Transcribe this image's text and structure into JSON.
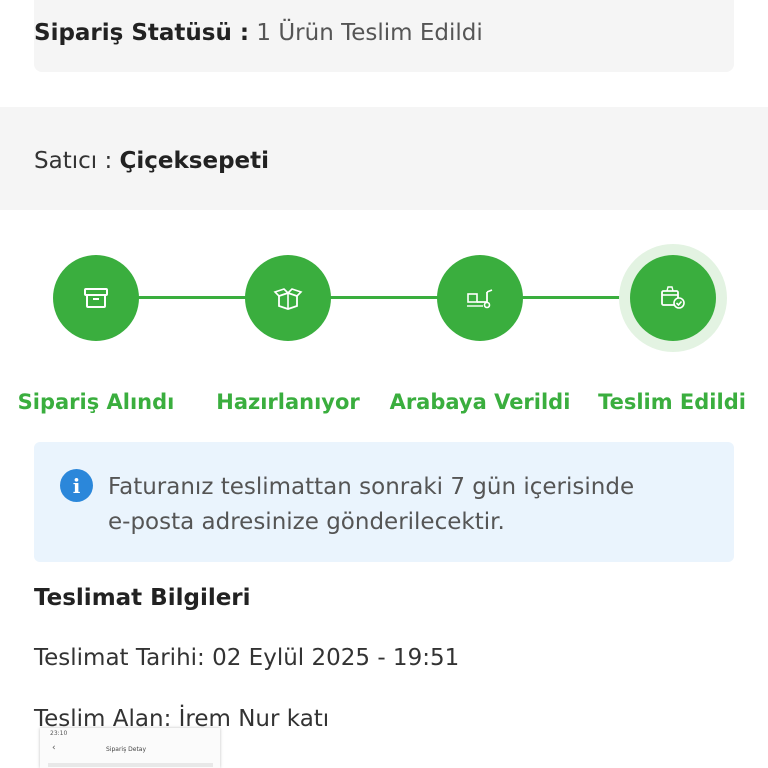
{
  "order_status": {
    "label": "Sipariş Statüsü :",
    "value": "1 Ürün Teslim Edildi"
  },
  "seller": {
    "label": "Satıcı :",
    "name": "Çiçeksepeti"
  },
  "tracker": {
    "accent_color": "#3aae3e",
    "steps": [
      {
        "label": "Sipariş Alındı",
        "icon": "archive-box-icon"
      },
      {
        "label": "Hazırlanıyor",
        "icon": "gift-box-icon"
      },
      {
        "label": "Arabaya Verildi",
        "icon": "delivery-truck-icon"
      },
      {
        "label": "Teslim Edildi",
        "icon": "delivered-box-check-icon"
      }
    ]
  },
  "info_notice": {
    "icon": "info-icon",
    "line1": "Faturanız teslimattan sonraki 7 gün içerisinde",
    "line2": "e-posta adresinize gönderilecektir."
  },
  "delivery_info": {
    "title": "Teslimat Bilgileri",
    "date": "Teslimat Tarihi: 02 Eylül 2025 - 19:51",
    "receiver": "Teslim Alan: İrem Nur katı"
  },
  "overlay_screenshot": {
    "status_time": "23:10",
    "title": "Sipariş Detay"
  }
}
